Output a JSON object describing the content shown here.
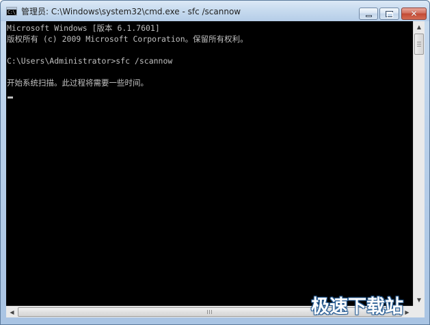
{
  "window": {
    "title": "管理员: C:\\Windows\\system32\\cmd.exe - sfc  /scannow",
    "icon": "cmd-icon",
    "icon_text": "C:\\_"
  },
  "caption_buttons": {
    "minimize": "minimize-icon",
    "maximize": "maximize-icon",
    "close": "close-icon",
    "close_glyph": "✕"
  },
  "console": {
    "lines": [
      "Microsoft Windows [版本 6.1.7601]",
      "版权所有 (c) 2009 Microsoft Corporation。保留所有权利。",
      "C:\\Users\\Administrator>sfc /scannow",
      "开始系统扫描。此过程将需要一些时间。"
    ],
    "foreground": "#c0c0c0",
    "background": "#000000"
  },
  "scrollbars": {
    "up_arrow": "▲",
    "down_arrow": "▼",
    "left_arrow": "◀",
    "right_arrow": "▶"
  },
  "watermark": "极速下载站"
}
